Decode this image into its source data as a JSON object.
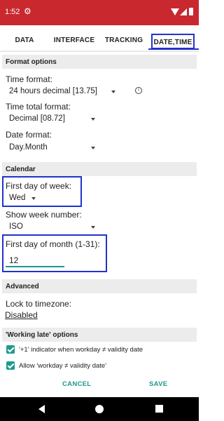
{
  "status": {
    "time": "1:52",
    "settings_icon": "gear-icon",
    "wifi_icon": "wifi-icon",
    "signal_icon": "signal-icon",
    "battery_icon": "battery-icon",
    "bar_color": "#c8282e"
  },
  "tabs": [
    {
      "label": "DATA",
      "selected": false
    },
    {
      "label": "INTERFACE",
      "selected": false
    },
    {
      "label": "TRACKING",
      "selected": false
    },
    {
      "label": "DATE,TIME",
      "selected": true
    }
  ],
  "format_options": {
    "header": "Format options",
    "time_format": {
      "label": "Time format:",
      "value": "24 hours decimal [13.75]",
      "info_icon": "info-icon"
    },
    "time_total_format": {
      "label": "Time total format:",
      "value": "Decimal [08.72]"
    },
    "date_format": {
      "label": "Date format:",
      "value": "Day.Month"
    }
  },
  "calendar": {
    "header": "Calendar",
    "first_day_of_week": {
      "label": "First day of week:",
      "value": "Wed"
    },
    "show_week_number": {
      "label": "Show week number:",
      "value": "ISO"
    },
    "first_day_of_month": {
      "label": "First day of month (1-31):",
      "value": "12"
    }
  },
  "advanced": {
    "header": "Advanced",
    "lock_timezone": {
      "label": "Lock to timezone:",
      "value": "Disabled"
    }
  },
  "working_late": {
    "header": "'Working late' options",
    "option1": {
      "label": "'+1' indicator when workday ≠ validity date",
      "checked": true
    },
    "option2": {
      "label": "Allow 'workday ≠ validity date'",
      "checked": true
    }
  },
  "buttons": {
    "cancel": "CANCEL",
    "save": "SAVE"
  },
  "colors": {
    "accent": "#1e9a8c",
    "highlight": "#2233cc"
  },
  "navbar": {
    "back_icon": "back-icon",
    "home_icon": "home-icon",
    "recents_icon": "recents-icon"
  }
}
